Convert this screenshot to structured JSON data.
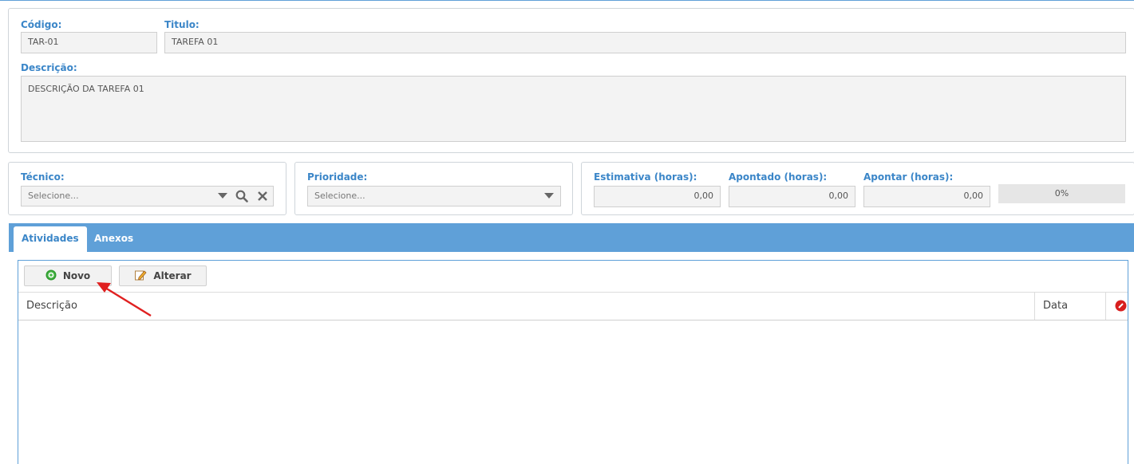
{
  "header_form": {
    "codigo_label": "Código:",
    "codigo_value": "TAR-01",
    "titulo_label": "Titulo:",
    "titulo_value": "TAREFA 01",
    "descricao_label": "Descrição:",
    "descricao_value": "DESCRIÇÃO DA TAREFA 01"
  },
  "tecnico": {
    "label": "Técnico:",
    "placeholder": "Selecione..."
  },
  "prioridade": {
    "label": "Prioridade:",
    "placeholder": "Selecione..."
  },
  "hours": {
    "estimativa_label": "Estimativa (horas):",
    "estimativa_value": "0,00",
    "apontado_label": "Apontado (horas):",
    "apontado_value": "0,00",
    "apontar_label": "Apontar (horas):",
    "apontar_value": "0,00",
    "progress_text": "0%",
    "progress_fraction": 0
  },
  "tabs": [
    {
      "label": "Atividades",
      "active": true
    },
    {
      "label": "Anexos",
      "active": false
    }
  ],
  "toolbar": {
    "novo_label": "Novo",
    "alterar_label": "Alterar"
  },
  "grid": {
    "columns": [
      "Descrição",
      "Data"
    ],
    "rows": []
  },
  "colors": {
    "accent": "#5fa0d8",
    "label_blue": "#3b86c8",
    "annotation_arrow": "#e02020"
  },
  "icons": {
    "dropdown": "chevron-down-icon",
    "search": "search-icon",
    "clear": "close-icon",
    "novo": "add-circle-icon",
    "alterar": "edit-pencil-icon",
    "delete_column": "delete-icon"
  }
}
